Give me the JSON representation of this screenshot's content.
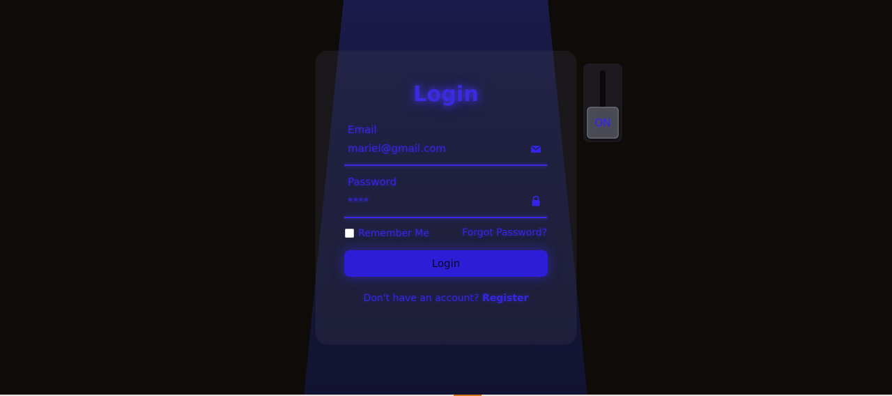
{
  "form": {
    "title": "Login",
    "email": {
      "label": "Email",
      "value": "mariel@gmail.com",
      "icon": "envelope-icon"
    },
    "password": {
      "label": "Password",
      "value": "****",
      "icon": "lock-icon"
    },
    "remember_label": "Remember Me",
    "remember_checked": false,
    "forgot_label": "Forgot Password?",
    "submit_label": "Login",
    "register_prompt": "Don't have an account?",
    "register_link": "Register"
  },
  "lamp_switch": {
    "label": "ON",
    "state": "on"
  },
  "colors": {
    "background": "#0f0b09",
    "accent": "#3425e6",
    "button": "#2b1ed6",
    "beam": "#1c1e56"
  }
}
